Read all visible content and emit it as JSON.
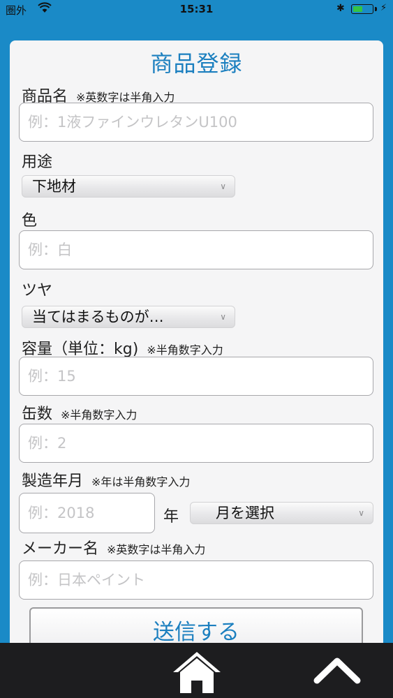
{
  "status_bar": {
    "carrier": "圏外",
    "time": "15:31",
    "bluetooth_icon": "bluetooth-icon",
    "battery_icon": "battery-icon",
    "battery_level": 0.5
  },
  "form": {
    "title": "商品登録",
    "product_name": {
      "label": "商品名",
      "note": "※英数字は半角入力",
      "placeholder": "例：1液ファインウレタンU100"
    },
    "usage": {
      "label": "用途",
      "selected": "下地材"
    },
    "color": {
      "label": "色",
      "placeholder": "例：白"
    },
    "gloss": {
      "label": "ツヤ",
      "selected": "当てはまるものが…"
    },
    "capacity": {
      "label": "容量（単位：kg)",
      "note": "※半角数字入力",
      "placeholder": "例：15"
    },
    "cans": {
      "label": "缶数",
      "note": "※半角数字入力",
      "placeholder": "例：2"
    },
    "manufacture": {
      "label": "製造年月",
      "note": "※年は半角数字入力",
      "year_placeholder": "例：2018",
      "year_unit": "年",
      "month_selected": "月を選択"
    },
    "maker": {
      "label": "メーカー名",
      "note": "※英数字は半角入力",
      "placeholder": "例：日本ペイント"
    },
    "submit_label": "送信する"
  },
  "bottom_bar": {
    "home_icon": "home-icon",
    "up_icon": "chevron-up-icon"
  },
  "colors": {
    "accent": "#1b7fbf",
    "background": "#1a8ac7",
    "bottom_bar": "#1d1d1f"
  }
}
